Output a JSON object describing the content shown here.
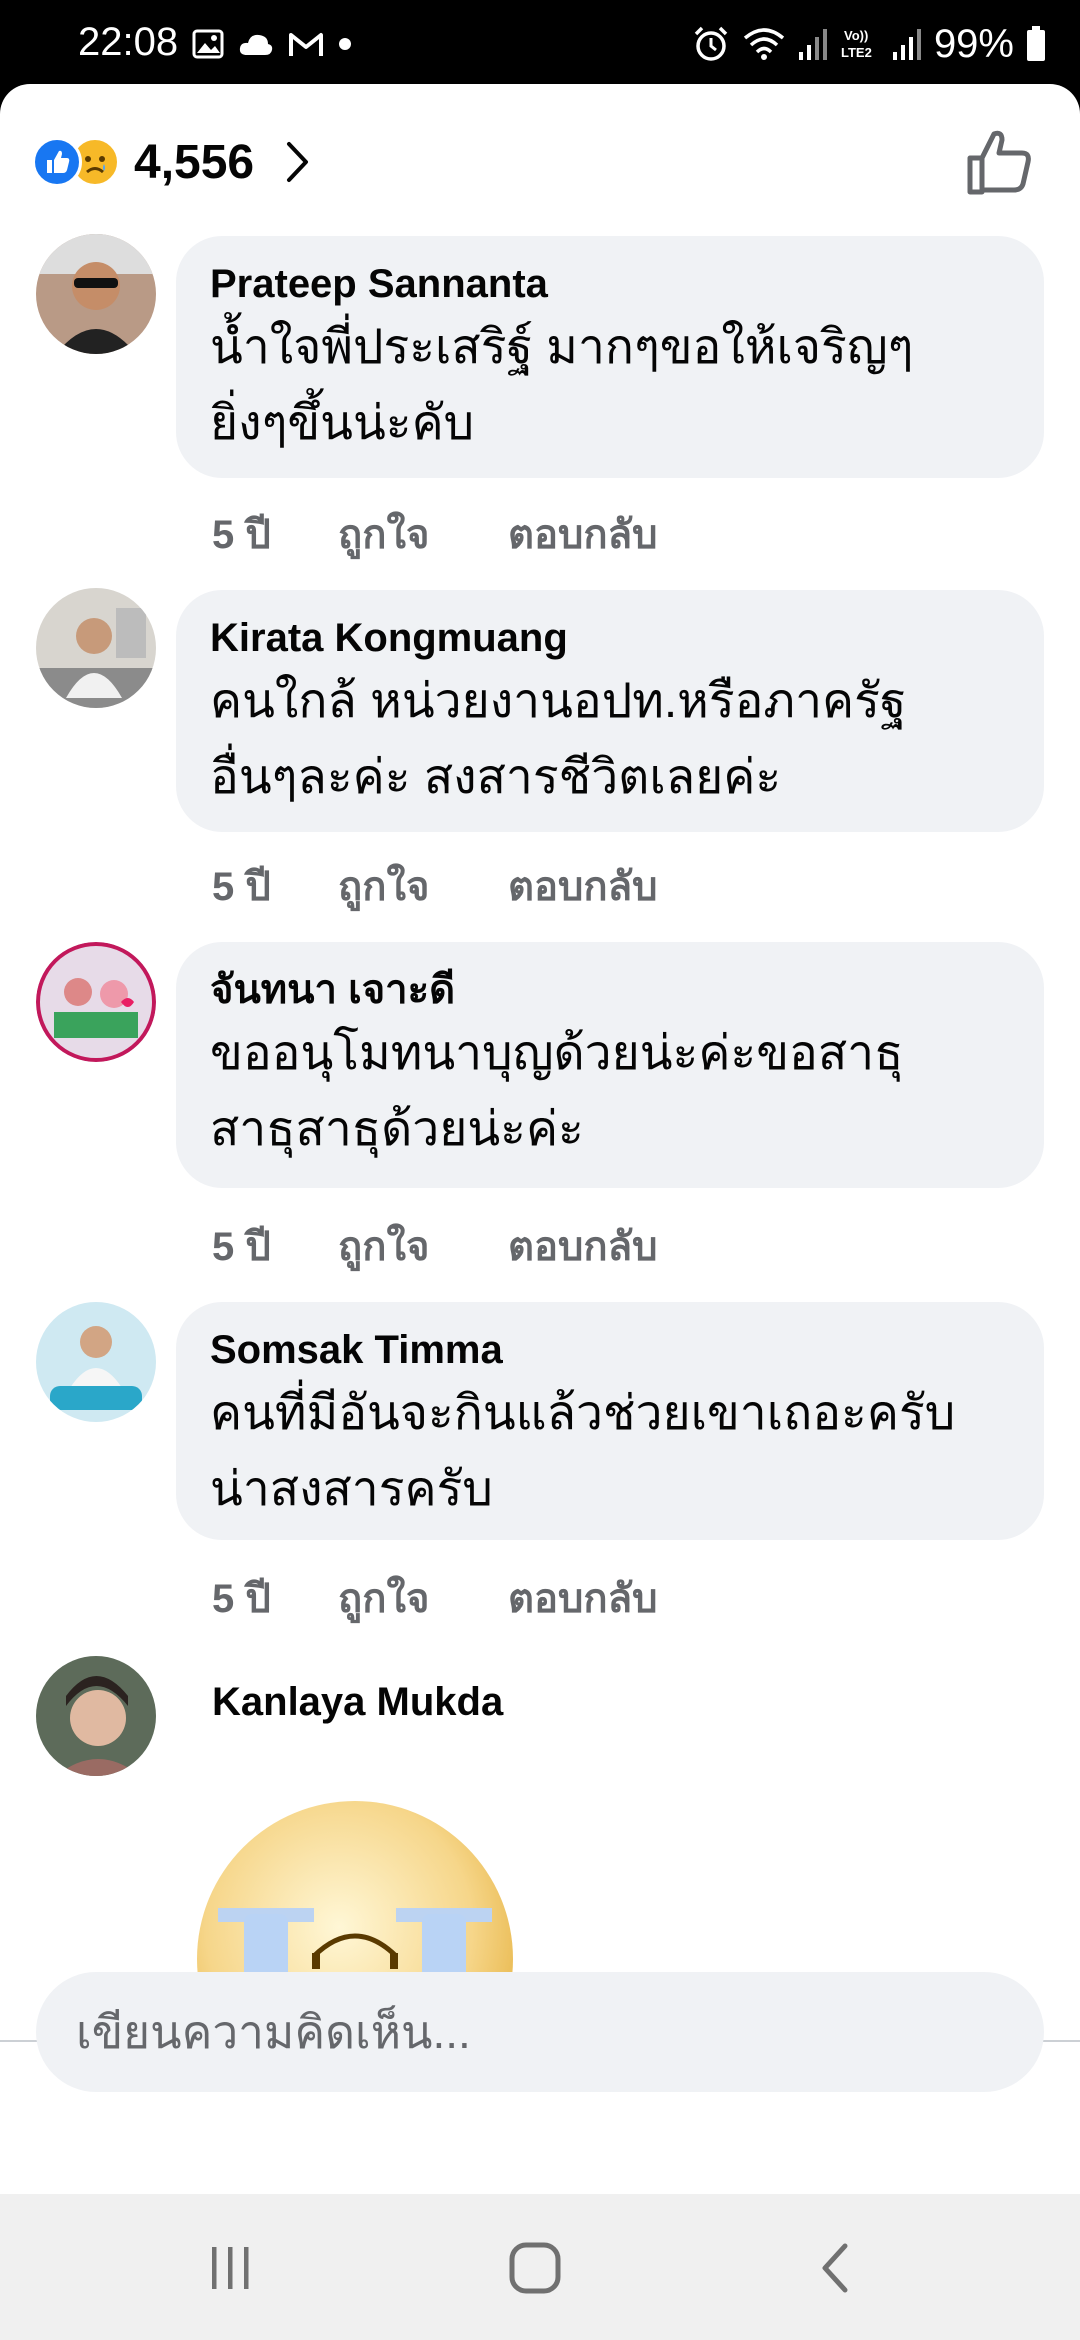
{
  "status_bar": {
    "time": "22:08",
    "battery_percent": "99%",
    "left_icons": [
      "gallery-icon",
      "cloud-icon",
      "gmail-icon",
      "dot-icon"
    ],
    "right_icons": [
      "alarm-icon",
      "wifi-icon",
      "signal-icon",
      "volte-lte2-icon",
      "signal-icon",
      "battery-icon"
    ]
  },
  "reactions": {
    "count": "4,556",
    "types": [
      "like",
      "sad"
    ]
  },
  "comments": [
    {
      "author": "Prateep Sannanta",
      "line1": "น้ำใจพี่ประเสริฐ์ มากๆขอให้เจริญๆ",
      "line2": "ยิ่งๆขึ้นน่ะคับ",
      "time": "5 ปี",
      "like": "ถูกใจ",
      "reply": "ตอบกลับ"
    },
    {
      "author": "Kirata Kongmuang",
      "line1": "คนใกล้ หน่วยงานอปท.หรือภาครัฐ",
      "line2": "อื่นๆละค่ะ สงสารชีวิตเลยค่ะ",
      "time": "5 ปี",
      "like": "ถูกใจ",
      "reply": "ตอบกลับ"
    },
    {
      "author": "จันทนา เจาะดี",
      "line1": "ขออนุโมทนาบุญด้วยน่ะค่ะขอสาธุ",
      "line2": "สาธุสาธุด้วยน่ะค่ะ",
      "time": "5 ปี",
      "like": "ถูกใจ",
      "reply": "ตอบกลับ"
    },
    {
      "author": "Somsak Timma",
      "line1": "คนที่มีอันจะกินแล้วช่วยเขาเถอะครับ",
      "line2": "น่าสงสารครับ",
      "time": "5 ปี",
      "like": "ถูกใจ",
      "reply": "ตอบกลับ"
    },
    {
      "author": "Kanlaya Mukda",
      "sticker": "crying-face-sticker"
    }
  ],
  "composer": {
    "placeholder": "เขียนความคิดเห็น..."
  },
  "nav": {
    "buttons": [
      "recents-icon",
      "home-icon",
      "back-icon"
    ]
  },
  "colors": {
    "brand_blue": "#1877f2",
    "bubble_bg": "#f0f2f5",
    "secondary_text": "#65676b",
    "sad_yellow": "#f7b928"
  }
}
